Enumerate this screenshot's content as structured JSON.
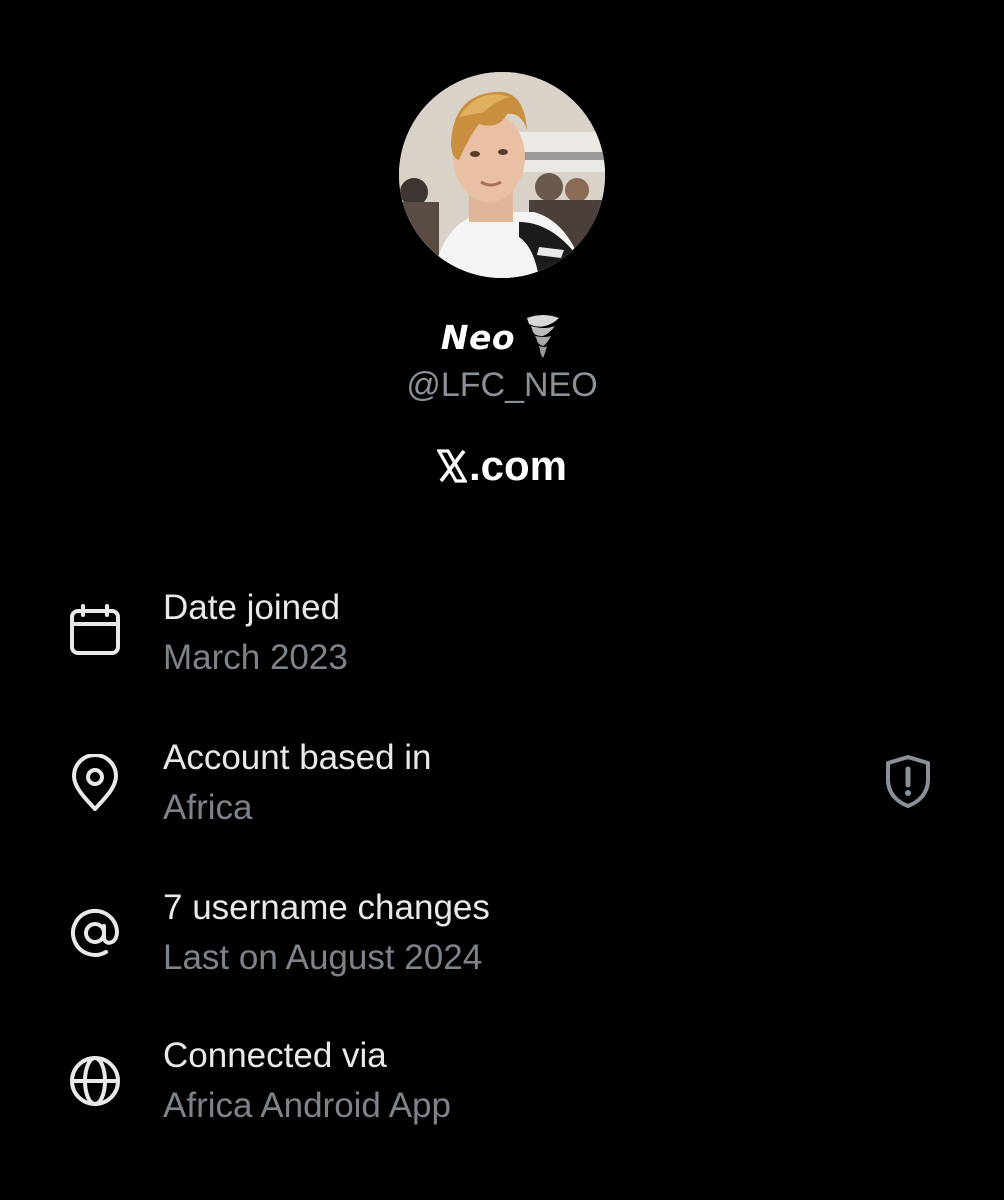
{
  "profile": {
    "display_name": "Neo",
    "name_emoji": "tornado-icon",
    "handle": "@LFC_NEO",
    "site": ".com"
  },
  "details": [
    {
      "icon": "calendar-icon",
      "title": "Date joined",
      "value": "March 2023"
    },
    {
      "icon": "location-pin-icon",
      "title": "Account based in",
      "value": "Africa"
    },
    {
      "icon": "at-sign-icon",
      "title": "7 username changes",
      "value": "Last on August 2024"
    },
    {
      "icon": "globe-icon",
      "title": "Connected via",
      "value": "Africa Android App"
    }
  ],
  "colors": {
    "background": "#000000",
    "primary_text": "#e7e9ea",
    "secondary_text": "#7d838a",
    "icon_stroke": "#e7e9ea",
    "shield_stroke": "#8b9198"
  }
}
